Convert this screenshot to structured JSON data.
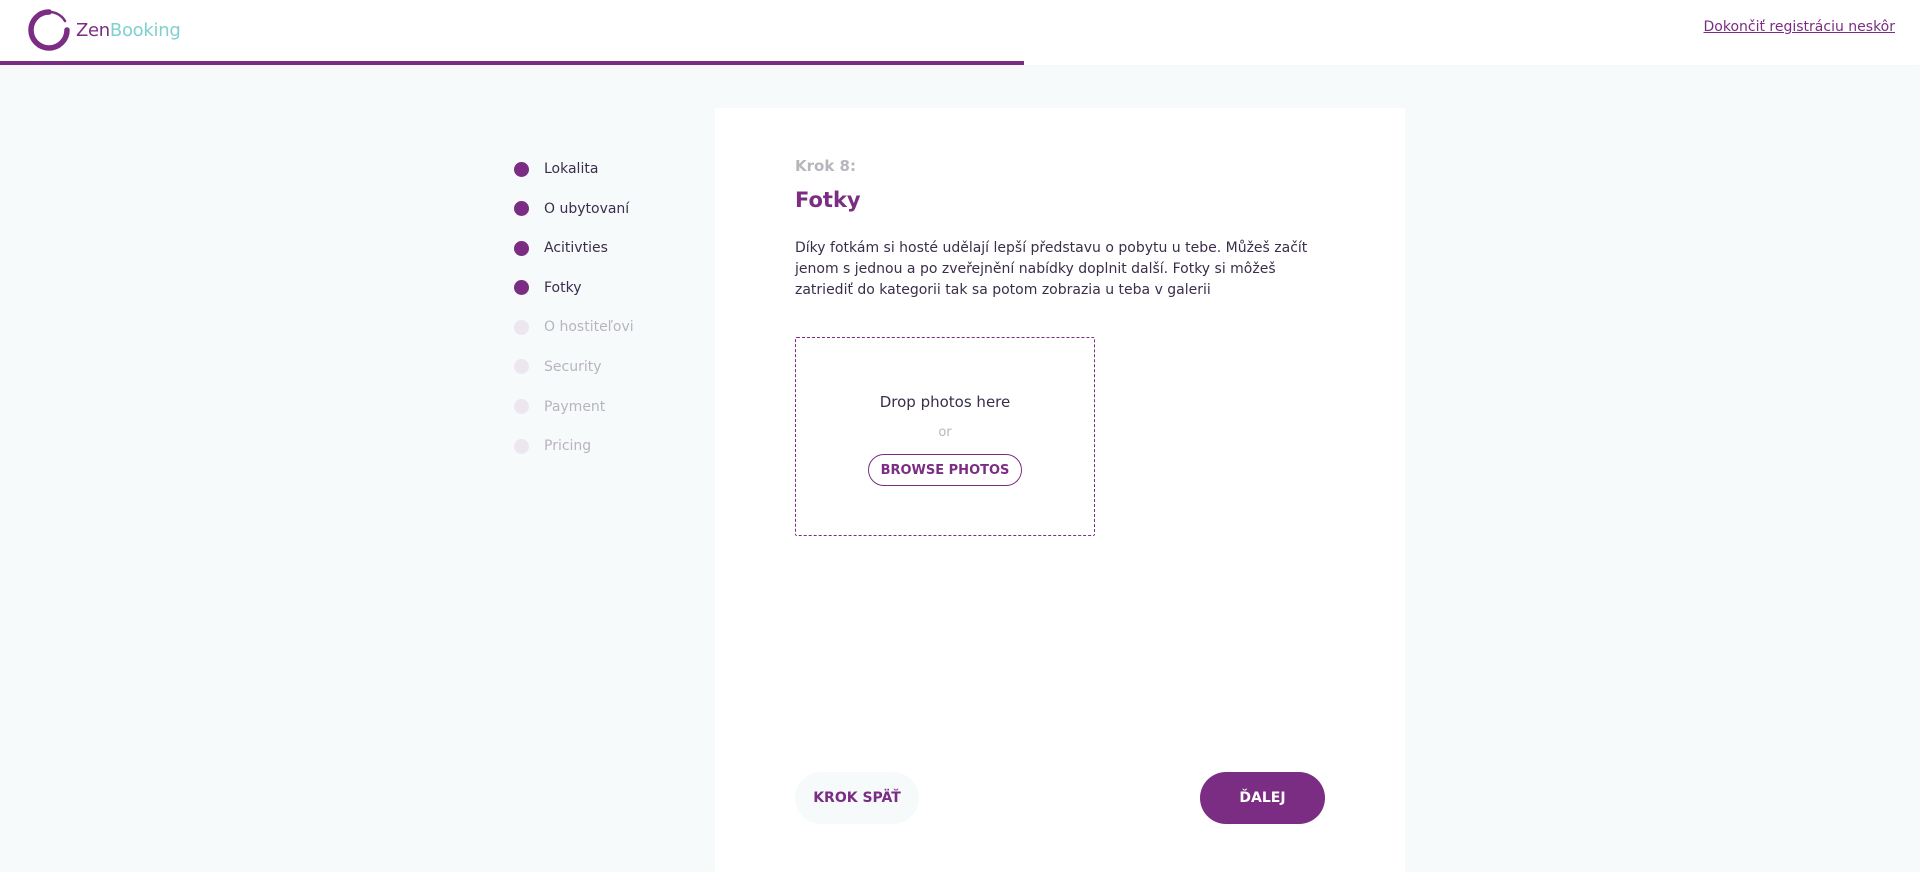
{
  "brand": {
    "name_part1": "Zen",
    "name_part2": "Booking",
    "logo_icon": "zenbooking-logo-icon",
    "primary_color": "#7b2d83",
    "secondary_color": "#7fd0cf"
  },
  "header": {
    "finish_later_link": "Dokončiť registráciu neskôr"
  },
  "progress": {
    "fraction": 0.5
  },
  "steps": [
    {
      "label": "Lokalita",
      "status": "done"
    },
    {
      "label": "O ubytovaní",
      "status": "done"
    },
    {
      "label": "Acitivties",
      "status": "done"
    },
    {
      "label": "Fotky",
      "status": "current"
    },
    {
      "label": "O hostiteľovi",
      "status": "pending"
    },
    {
      "label": "Security",
      "status": "pending"
    },
    {
      "label": "Payment",
      "status": "pending"
    },
    {
      "label": "Pricing",
      "status": "pending"
    }
  ],
  "main": {
    "step_label": "Krok 8:",
    "title": "Fotky",
    "description": "Díky fotkám si hosté udělají lepší představu o pobytu u tebe. Můžeš začít jenom s jednou a po zveřejnění nabídky doplnit další. Fotky si môžeš zatriediť do kategorii tak sa potom zobrazia u teba v galerii",
    "dropzone": {
      "drop_text": "Drop photos here",
      "or_text": "or",
      "browse_label": "BROWSE PHOTOS"
    },
    "back_label": "KROK SPÄŤ",
    "next_label": "ĎALEJ"
  }
}
